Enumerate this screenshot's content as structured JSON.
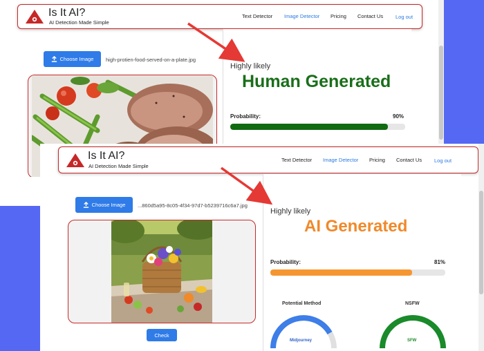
{
  "brand": {
    "title": "Is It AI?",
    "subtitle": "AI Detection Made Simple"
  },
  "nav": {
    "items": [
      {
        "label": "Text Detector"
      },
      {
        "label": "Image Detector"
      },
      {
        "label": "Pricing"
      },
      {
        "label": "Contact Us"
      },
      {
        "label": "Log out"
      }
    ],
    "active": "Image Detector"
  },
  "top": {
    "choose_label": "Choose Image",
    "filename": "high-protien-food-served-on-a-plate.jpg",
    "highly": "Highly likely",
    "verdict": "Human Generated",
    "probability_label": "Probability:",
    "probability_value": "90%",
    "probability": 0.9
  },
  "bottom": {
    "choose_label": "Choose Image",
    "filename": "...860d5a95-8c05-4f34-97d7-b5239716c6a7.jpg",
    "highly": "Highly likely",
    "verdict": "AI Generated",
    "probability_label": "Probability:",
    "probability_value": "81%",
    "probability": 0.81,
    "check_label": "Check",
    "potential_method_title": "Potential Method",
    "nsfw_title": "NSFW",
    "method_gauge_label": "Midjourney",
    "nsfw_gauge_label": "SFW"
  },
  "colors": {
    "human_green": "#1a6e1a",
    "ai_orange": "#f0892a",
    "accent_blue": "#2f7be8",
    "bar_green": "#116b11",
    "bar_orange": "#f59631",
    "border_red": "#c62828",
    "backdrop_blue": "#5468f4"
  }
}
